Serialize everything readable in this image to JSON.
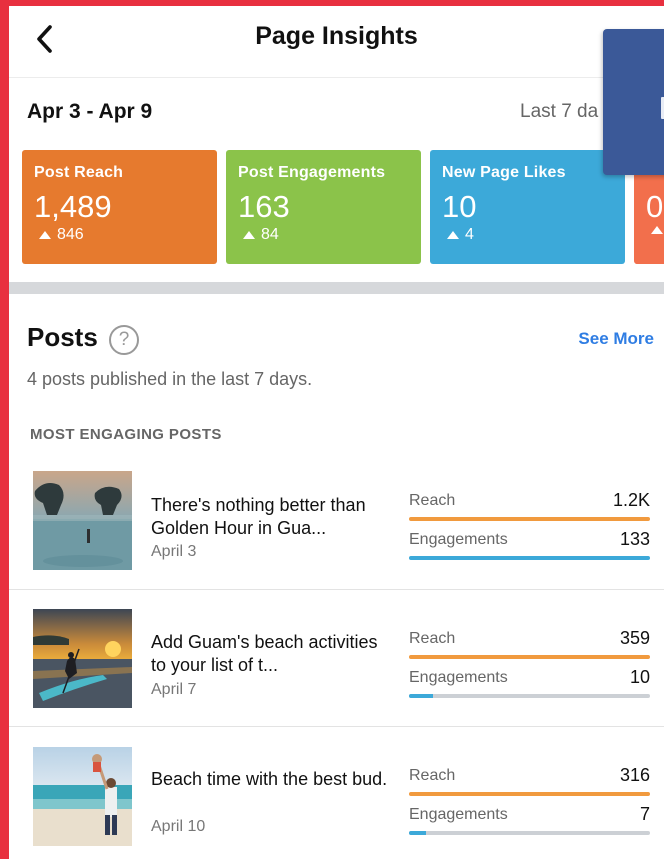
{
  "header": {
    "title": "Page Insights"
  },
  "date_range": "Apr 3 - Apr 9",
  "period_label": "Last 7 da",
  "cards": [
    {
      "label": "Post Reach",
      "value": "1,489",
      "delta": "846",
      "color": "#e67a2e"
    },
    {
      "label": "Post Engagements",
      "value": "163",
      "delta": "84",
      "color": "#8bc34a"
    },
    {
      "label": "New Page Likes",
      "value": "10",
      "delta": "4",
      "color": "#3ca9d9"
    },
    {
      "label": "",
      "value": "0",
      "delta": "",
      "color": "#f26f4c"
    }
  ],
  "posts": {
    "heading": "Posts",
    "help_glyph": "?",
    "see_more": "See More",
    "subtitle": "4 posts published in the last 7 days.",
    "section_label": "MOST ENGAGING POSTS",
    "items": [
      {
        "title": "There's nothing better than Golden Hour in Gua...",
        "date": "April 3",
        "reach_label": "Reach",
        "reach_value": "1.2K",
        "reach_fraction": 1.0,
        "eng_label": "Engagements",
        "eng_value": "133",
        "eng_fraction": 1.0
      },
      {
        "title": "Add Guam's beach activities to your list of t...",
        "date": "April 7",
        "reach_label": "Reach",
        "reach_value": "359",
        "reach_fraction": 1.0,
        "eng_label": "Engagements",
        "eng_value": "10",
        "eng_fraction": 0.1
      },
      {
        "title": "Beach time with the best bud.",
        "date": "April 10",
        "reach_label": "Reach",
        "reach_value": "316",
        "reach_fraction": 1.0,
        "eng_label": "Engagements",
        "eng_value": "7",
        "eng_fraction": 0.07
      }
    ]
  }
}
